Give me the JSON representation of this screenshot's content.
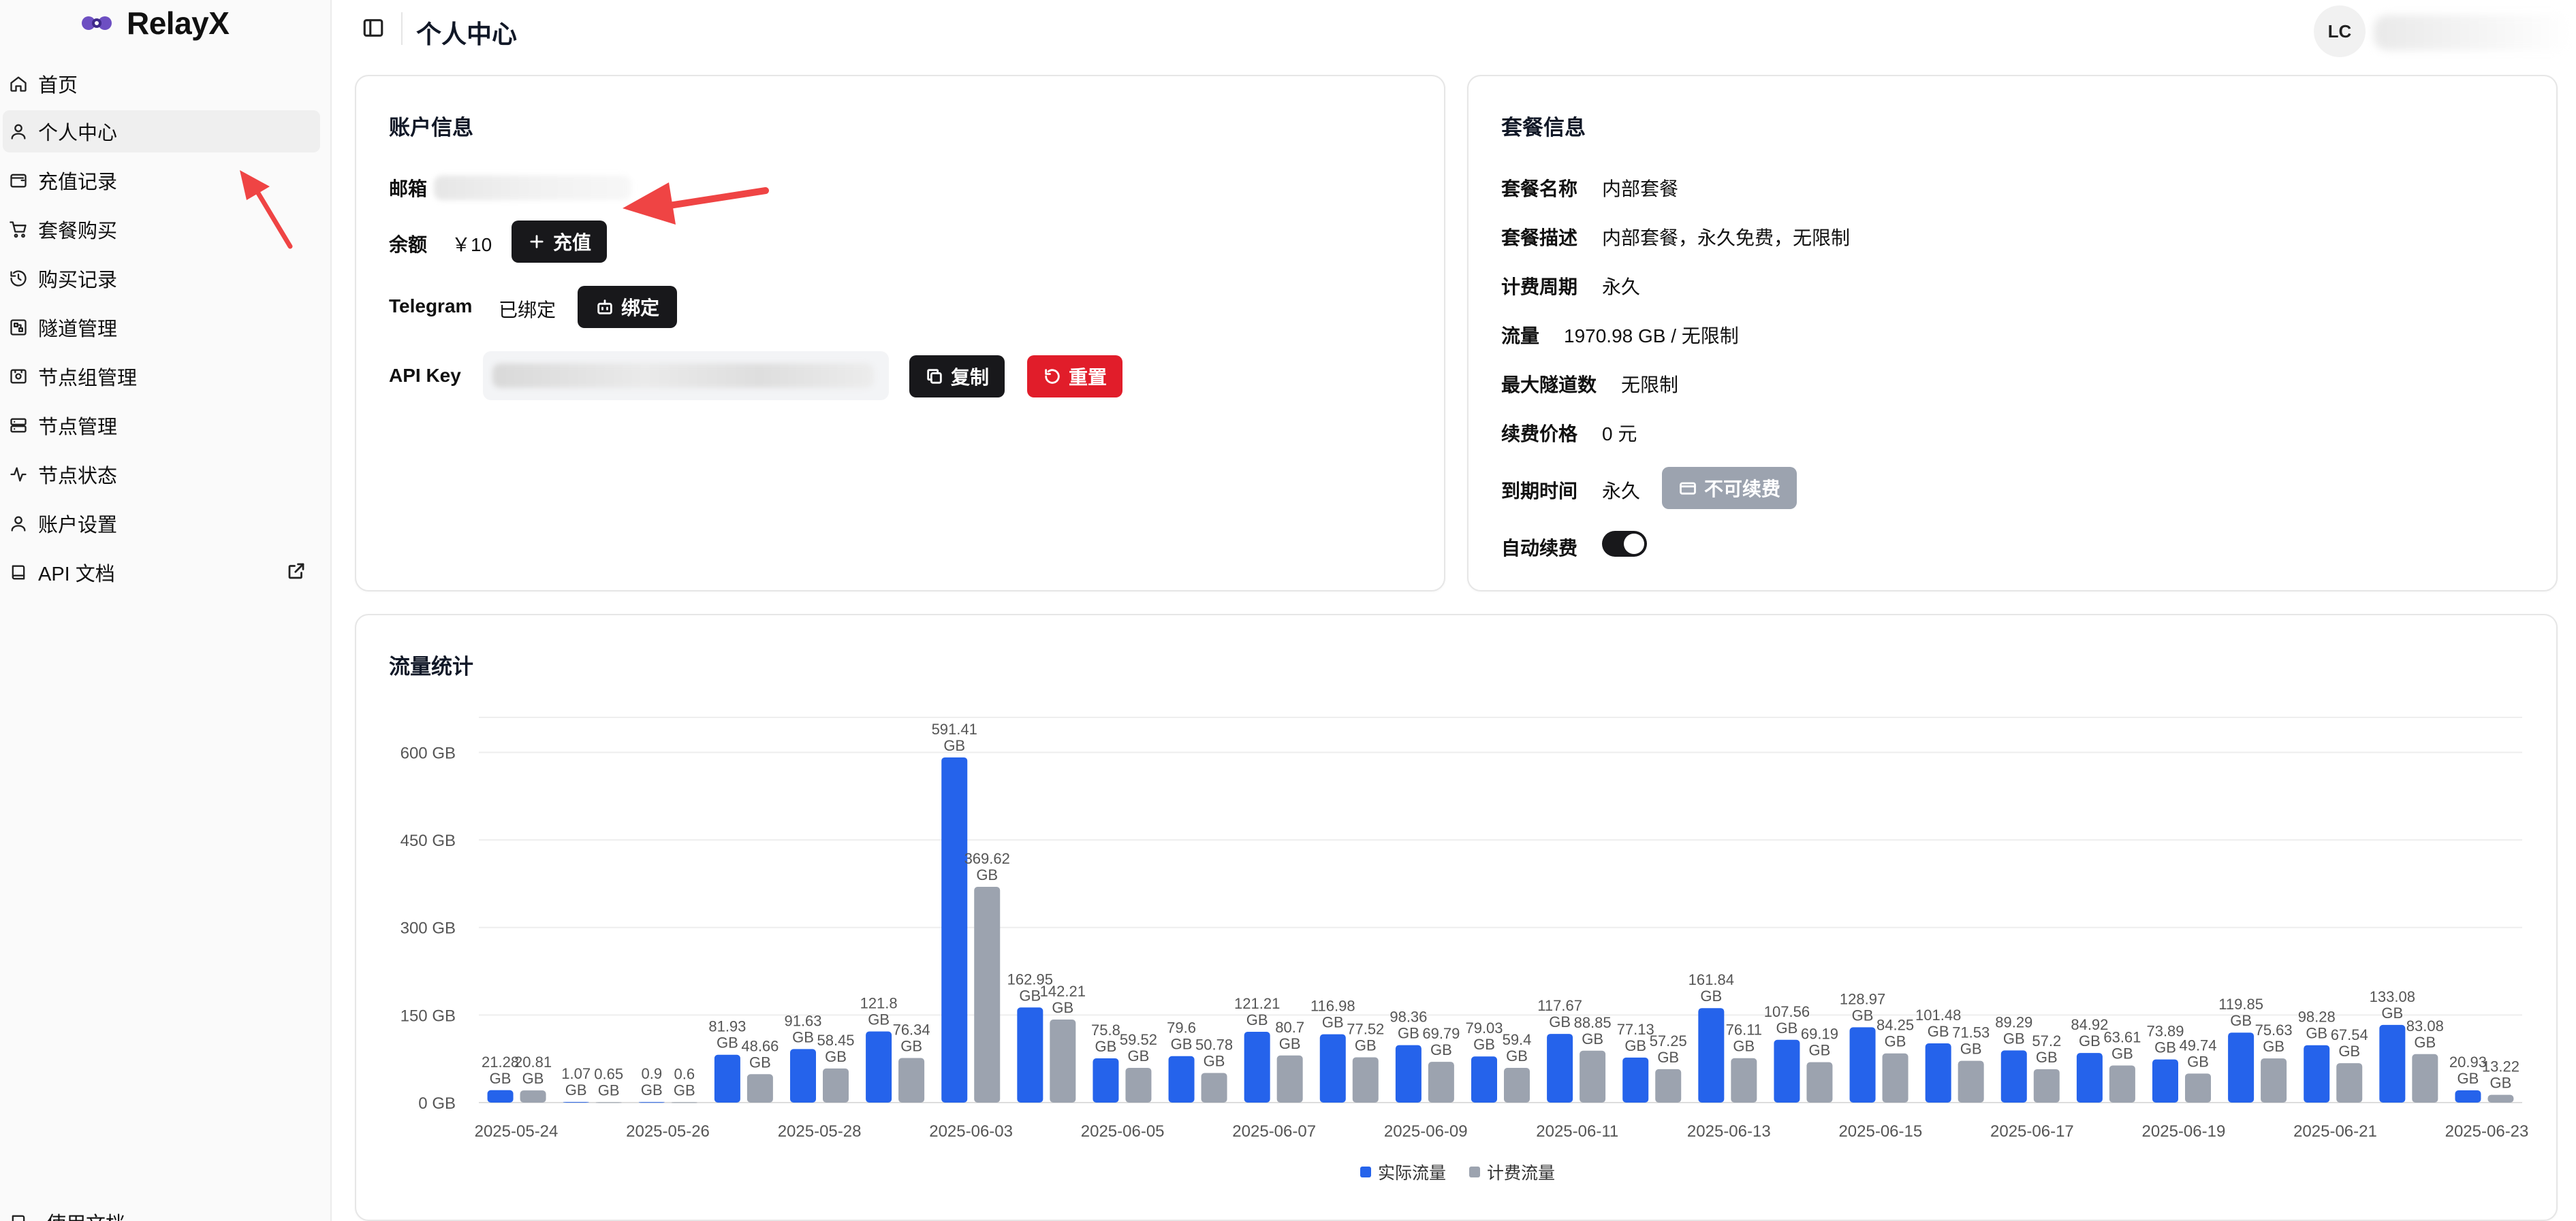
{
  "brand": {
    "name": "RelayX"
  },
  "header": {
    "title": "个人中心",
    "avatar_initials": "LC"
  },
  "sidebar": {
    "items": [
      {
        "label": "首页",
        "icon": "home-icon"
      },
      {
        "label": "个人中心",
        "icon": "user-icon",
        "active": true
      },
      {
        "label": "充值记录",
        "icon": "wallet-icon"
      },
      {
        "label": "套餐购买",
        "icon": "cart-icon"
      },
      {
        "label": "购买记录",
        "icon": "history-icon"
      },
      {
        "label": "隧道管理",
        "icon": "tunnel-icon"
      },
      {
        "label": "节点组管理",
        "icon": "node-group-icon"
      },
      {
        "label": "节点管理",
        "icon": "server-icon"
      },
      {
        "label": "节点状态",
        "icon": "activity-icon"
      },
      {
        "label": "账户设置",
        "icon": "user-settings-icon"
      },
      {
        "label": "API 文档",
        "icon": "book-icon",
        "external": true
      }
    ],
    "bottom_label": "使用文档"
  },
  "account": {
    "title": "账户信息",
    "email_label": "邮箱",
    "balance_label": "余额",
    "balance_value": "￥10",
    "recharge_button": "充值",
    "telegram_label": "Telegram",
    "telegram_status": "已绑定",
    "bind_button": "绑定",
    "apikey_label": "API Key",
    "copy_button": "复制",
    "reset_button": "重置"
  },
  "plan": {
    "title": "套餐信息",
    "rows": [
      {
        "label": "套餐名称",
        "value": "内部套餐"
      },
      {
        "label": "套餐描述",
        "value": "内部套餐，永久免费，无限制"
      },
      {
        "label": "计费周期",
        "value": "永久"
      },
      {
        "label": "流量",
        "value": "1970.98 GB / 无限制"
      },
      {
        "label": "最大隧道数",
        "value": "无限制"
      },
      {
        "label": "续费价格",
        "value": "0 元"
      },
      {
        "label": "到期时间",
        "value": "永久"
      }
    ],
    "renew_button": "不可续费",
    "autorenew_label": "自动续费",
    "autorenew_on": true
  },
  "traffic": {
    "title": "流量统计"
  },
  "chart_data": {
    "type": "bar",
    "title": "流量统计",
    "unit": "GB",
    "ylim": [
      0,
      660
    ],
    "yticks": [
      0,
      150,
      300,
      450,
      600
    ],
    "ytick_labels": [
      "0 GB",
      "150 GB",
      "300 GB",
      "450 GB",
      "600 GB"
    ],
    "x_tick_labels": [
      "2025-05-24",
      "2025-05-26",
      "2025-05-28",
      "2025-06-03",
      "2025-06-05",
      "2025-06-07",
      "2025-06-09",
      "2025-06-11",
      "2025-06-13",
      "2025-06-15",
      "2025-06-17",
      "2025-06-19",
      "2025-06-21",
      "2025-06-23"
    ],
    "legend_position": "bottom-center",
    "colors": {
      "actual": "#2563eb",
      "billed": "#9ca3af"
    },
    "series": [
      {
        "name": "实际流量",
        "values": [
          21.28,
          1.07,
          0.9,
          81.93,
          91.63,
          121.8,
          591.41,
          162.95,
          75.8,
          79.6,
          121.21,
          116.98,
          98.36,
          79.03,
          117.67,
          77.13,
          161.84,
          107.56,
          128.97,
          101.48,
          89.29,
          84.92,
          73.89,
          119.85,
          98.28,
          133.08,
          20.93
        ]
      },
      {
        "name": "计费流量",
        "values": [
          20.81,
          0.65,
          0.6,
          48.66,
          58.45,
          76.34,
          369.62,
          142.21,
          59.52,
          50.78,
          80.7,
          77.52,
          69.79,
          59.4,
          88.85,
          57.25,
          76.11,
          69.19,
          84.25,
          71.53,
          57.2,
          63.61,
          49.74,
          75.63,
          67.54,
          83.08,
          13.22
        ]
      }
    ]
  }
}
